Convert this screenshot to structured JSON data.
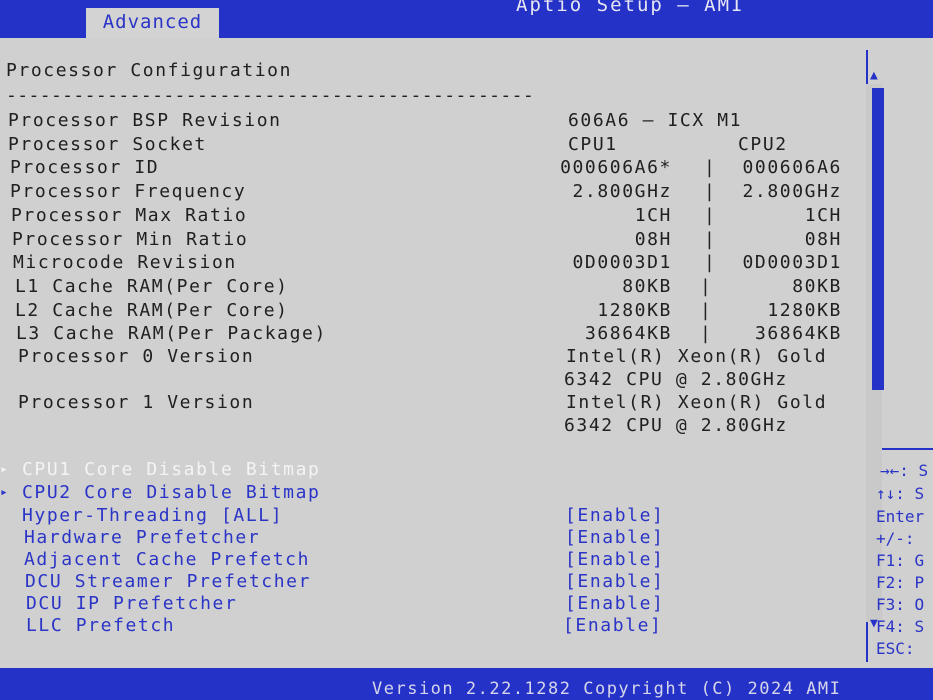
{
  "header": {
    "title": "Aptio Setup – AMI",
    "active_tab": "Advanced"
  },
  "section": {
    "title": "Processor Configuration",
    "divider": "-----------------------------------------------"
  },
  "info_rows": [
    {
      "label": "Processor BSP Revision",
      "value": "606A6 – ICX M1"
    },
    {
      "label": "Processor Socket",
      "cpu1": "CPU1",
      "cpu2": "CPU2"
    },
    {
      "label": "Processor ID",
      "cpu1": "000606A6*",
      "cpu2": "000606A6"
    },
    {
      "label": "Processor Frequency",
      "cpu1": "2.800GHz",
      "cpu2": "2.800GHz"
    },
    {
      "label": "Processor Max Ratio",
      "cpu1": "1CH",
      "cpu2": "1CH"
    },
    {
      "label": "Processor Min Ratio",
      "cpu1": "08H",
      "cpu2": "08H"
    },
    {
      "label": "Microcode Revision",
      "cpu1": "0D0003D1",
      "cpu2": "0D0003D1"
    },
    {
      "label": "L1 Cache RAM(Per Core)",
      "cpu1": "80KB",
      "cpu2": "80KB"
    },
    {
      "label": "L2 Cache RAM(Per Core)",
      "cpu1": "1280KB",
      "cpu2": "1280KB"
    },
    {
      "label": "L3 Cache RAM(Per Package)",
      "cpu1": "36864KB",
      "cpu2": "36864KB"
    }
  ],
  "separator_char": "|",
  "versions": [
    {
      "label": "Processor 0 Version",
      "line1": "Intel(R) Xeon(R) Gold",
      "line2": "6342 CPU @ 2.80GHz"
    },
    {
      "label": "Processor 1 Version",
      "line1": "Intel(R) Xeon(R) Gold",
      "line2": "6342 CPU @ 2.80GHz"
    }
  ],
  "submenus": [
    {
      "label": "CPU1 Core Disable Bitmap",
      "marker": "▸"
    },
    {
      "label": "CPU2 Core Disable Bitmap",
      "marker": "▸"
    }
  ],
  "settings": [
    {
      "label": "Hyper-Threading [ALL]",
      "value": "[Enable]"
    },
    {
      "label": "Hardware Prefetcher",
      "value": "[Enable]"
    },
    {
      "label": "Adjacent Cache Prefetch",
      "value": "[Enable]"
    },
    {
      "label": "DCU Streamer Prefetcher",
      "value": "[Enable]"
    },
    {
      "label": "DCU IP Prefetcher",
      "value": "[Enable]"
    },
    {
      "label": "LLC Prefetch",
      "value": "[Enable]"
    }
  ],
  "help": [
    "→←: S",
    "↑↓: S",
    "Enter",
    "+/-: ",
    "F1: G",
    "F2: P",
    "F3: O",
    "F4: S",
    "ESC: "
  ],
  "scroll": {
    "up": "▲",
    "down": "▼"
  },
  "footer": "Version 2.22.1282 Copyright (C) 2024 AMI"
}
